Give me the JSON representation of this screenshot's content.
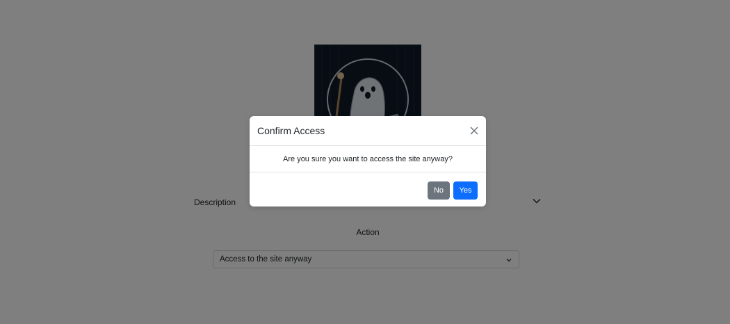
{
  "page": {
    "hero_image": {
      "icon": "ghost-with-shield-image"
    },
    "description_label": "Description",
    "description_toggle_icon": "chevron-down-icon",
    "action_title": "Action",
    "action_select": {
      "selected": "Access to the site anyway",
      "icon": "chevron-down-icon"
    }
  },
  "modal": {
    "title": "Confirm Access",
    "close_icon": "close-icon",
    "body": "Are you sure you want to access the site anyway?",
    "no_label": "No",
    "yes_label": "Yes"
  },
  "colors": {
    "backdrop": "#808080",
    "no_button": "#6c757d",
    "yes_button": "#0d6efd"
  }
}
